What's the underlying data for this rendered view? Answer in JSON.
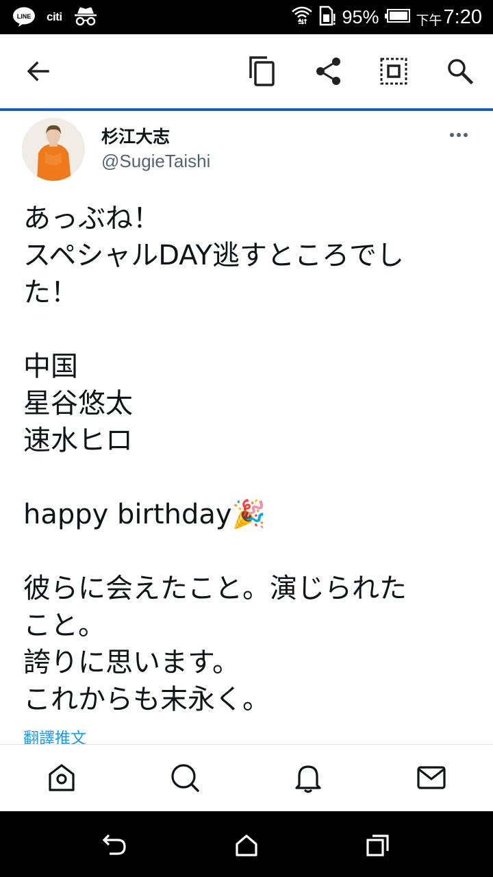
{
  "status_bar": {
    "line_label": "LINE",
    "citi_label": "citi",
    "battery_percent": "95%",
    "clock_ampm": "下午",
    "clock_time": "7:20",
    "icons": [
      "line-icon",
      "citi-icon",
      "incognito-icon",
      "wifi-icon",
      "sim-icon",
      "battery-icon"
    ]
  },
  "toolbar": {
    "icons": [
      "back-arrow-icon",
      "copy-icon",
      "share-icon",
      "screenshot-icon",
      "search-icon"
    ]
  },
  "tweet": {
    "display_name": "杉江大志",
    "handle": "@SugieTaishi",
    "lines": [
      "あっぶね！",
      "スペシャルDAY逃すところでし",
      "た！",
      "",
      "中国",
      "星谷悠太",
      "速水ヒロ",
      "",
      "happy birthday🎉",
      "",
      "彼らに会えたこと。演じられた",
      "こと。",
      "誇りに思います。",
      "これからも末永く。"
    ],
    "translate_label": "翻譯推文"
  },
  "bottom_nav": {
    "icons": [
      "home-icon",
      "search-icon",
      "notifications-icon",
      "messages-icon"
    ]
  },
  "system_nav": {
    "icons": [
      "back-icon",
      "home-icon",
      "recents-icon"
    ]
  },
  "colors": {
    "accent_line": "#1a56c4",
    "link": "#1d9bf0",
    "secondary_text": "#536471"
  }
}
